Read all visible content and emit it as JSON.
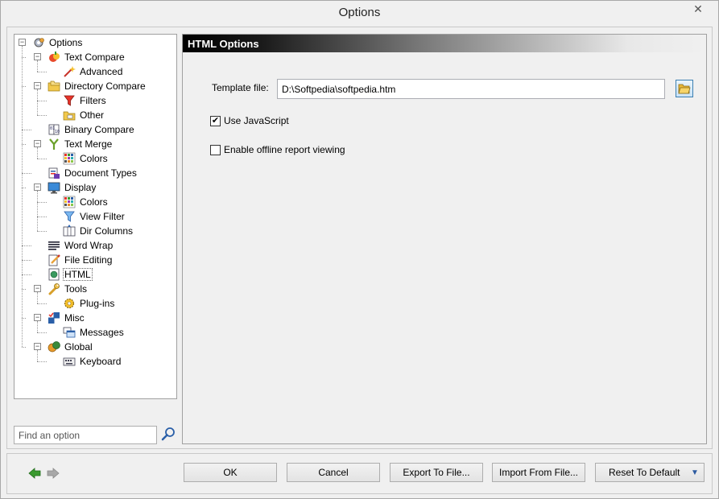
{
  "window": {
    "title": "Options",
    "close_glyph": "✕"
  },
  "tree": {
    "items": [
      {
        "label": "Options",
        "icon": "options-gear-icon",
        "expander": "−"
      },
      {
        "label": "Text Compare",
        "icon": "text-compare-icon",
        "expander": "−"
      },
      {
        "label": "Advanced",
        "icon": "magic-wand-icon"
      },
      {
        "label": "Directory Compare",
        "icon": "folder-compare-icon",
        "expander": "−"
      },
      {
        "label": "Filters",
        "icon": "filter-red-icon"
      },
      {
        "label": "Other",
        "icon": "folder-other-icon"
      },
      {
        "label": "Binary Compare",
        "icon": "binary-compare-icon"
      },
      {
        "label": "Text Merge",
        "icon": "merge-icon",
        "expander": "−"
      },
      {
        "label": "Colors",
        "icon": "color-grid-icon"
      },
      {
        "label": "Document Types",
        "icon": "document-types-icon"
      },
      {
        "label": "Display",
        "icon": "monitor-icon",
        "expander": "−"
      },
      {
        "label": "Colors",
        "icon": "color-grid-icon"
      },
      {
        "label": "View Filter",
        "icon": "filter-blue-icon"
      },
      {
        "label": "Dir Columns",
        "icon": "dir-columns-icon"
      },
      {
        "label": "Word Wrap",
        "icon": "word-wrap-icon"
      },
      {
        "label": "File Editing",
        "icon": "file-editing-icon"
      },
      {
        "label": "HTML",
        "icon": "html-icon"
      },
      {
        "label": "Tools",
        "icon": "wrench-icon",
        "expander": "−"
      },
      {
        "label": "Plug-ins",
        "icon": "plugin-gear-icon"
      },
      {
        "label": "Misc",
        "icon": "misc-icon",
        "expander": "−"
      },
      {
        "label": "Messages",
        "icon": "messages-icon"
      },
      {
        "label": "Global",
        "icon": "global-icon",
        "expander": "−"
      },
      {
        "label": "Keyboard",
        "icon": "keyboard-icon"
      }
    ]
  },
  "search": {
    "placeholder": "Find an option",
    "value": ""
  },
  "panel": {
    "header": "HTML Options",
    "template_label": "Template file:",
    "template_value": "D:\\Softpedia\\softpedia.htm",
    "use_js_label": "Use JavaScript",
    "use_js_checked": true,
    "offline_label": "Enable offline report viewing",
    "offline_checked": false,
    "check_glyph": "✔"
  },
  "buttons": {
    "ok": "OK",
    "cancel": "Cancel",
    "export": "Export To File...",
    "import": "Import From File...",
    "reset": "Reset To Default",
    "reset_arrow": "▼"
  },
  "colors": {
    "nav_back": "#3a9a2f",
    "nav_forward": "#9a9a9a"
  }
}
